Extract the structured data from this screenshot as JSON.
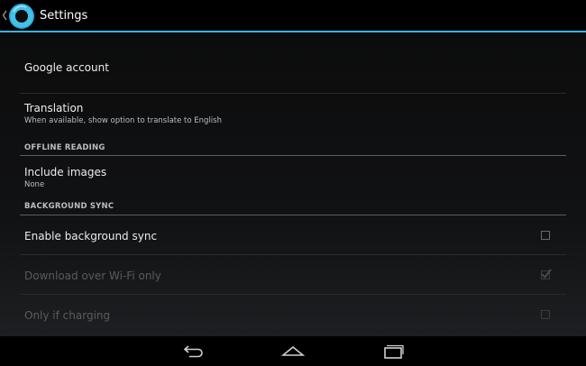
{
  "action_bar": {
    "title": "Settings",
    "accent": "#33b5e5",
    "up_icon": "chevron-left-icon",
    "app_icon": "ring-logo-icon"
  },
  "prefs": {
    "google_account": {
      "title": "Google account"
    },
    "translation": {
      "title": "Translation",
      "summary": "When available, show option to translate to English"
    },
    "offline_reading": {
      "header": "OFFLINE READING",
      "include_images": {
        "title": "Include images",
        "summary": "None"
      }
    },
    "background_sync": {
      "header": "BACKGROUND SYNC",
      "enable": {
        "title": "Enable background sync",
        "checked": false,
        "enabled": true
      },
      "wifi_only": {
        "title": "Download over Wi-Fi only",
        "checked": true,
        "enabled": false
      },
      "charging_only": {
        "title": "Only if charging",
        "checked": false,
        "enabled": false
      }
    }
  },
  "nav_bar": {
    "buttons": [
      "back-icon",
      "home-icon",
      "recent-apps-icon"
    ]
  }
}
